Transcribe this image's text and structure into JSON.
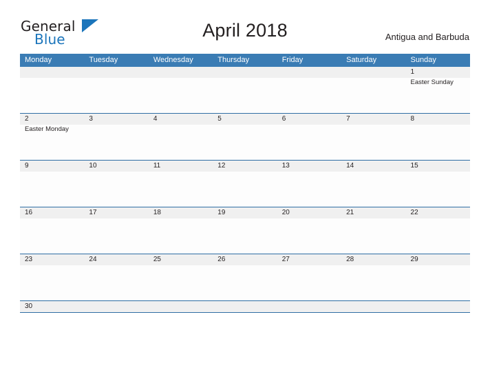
{
  "brand": {
    "word_one": "General",
    "word_two": "Blue",
    "triangle_icon": "triangle-right-icon",
    "color_dark": "#231f20",
    "color_blue": "#1b75bb"
  },
  "header": {
    "title": "April 2018",
    "region": "Antigua and Barbuda"
  },
  "theme": {
    "header_blue": "#3a7cb4",
    "rule_blue": "#2e6da4",
    "date_band_gray": "#f0f0f0",
    "body_white": "#fdfdfd",
    "text": "#231f20"
  },
  "calendar": {
    "weekdays": [
      "Monday",
      "Tuesday",
      "Wednesday",
      "Thursday",
      "Friday",
      "Saturday",
      "Sunday"
    ],
    "weeks": [
      {
        "short": false,
        "days": [
          {
            "num": "",
            "events": []
          },
          {
            "num": "",
            "events": []
          },
          {
            "num": "",
            "events": []
          },
          {
            "num": "",
            "events": []
          },
          {
            "num": "",
            "events": []
          },
          {
            "num": "",
            "events": []
          },
          {
            "num": "1",
            "events": [
              "Easter Sunday"
            ]
          }
        ]
      },
      {
        "short": false,
        "days": [
          {
            "num": "2",
            "events": [
              "Easter Monday"
            ]
          },
          {
            "num": "3",
            "events": []
          },
          {
            "num": "4",
            "events": []
          },
          {
            "num": "5",
            "events": []
          },
          {
            "num": "6",
            "events": []
          },
          {
            "num": "7",
            "events": []
          },
          {
            "num": "8",
            "events": []
          }
        ]
      },
      {
        "short": false,
        "days": [
          {
            "num": "9",
            "events": []
          },
          {
            "num": "10",
            "events": []
          },
          {
            "num": "11",
            "events": []
          },
          {
            "num": "12",
            "events": []
          },
          {
            "num": "13",
            "events": []
          },
          {
            "num": "14",
            "events": []
          },
          {
            "num": "15",
            "events": []
          }
        ]
      },
      {
        "short": false,
        "days": [
          {
            "num": "16",
            "events": []
          },
          {
            "num": "17",
            "events": []
          },
          {
            "num": "18",
            "events": []
          },
          {
            "num": "19",
            "events": []
          },
          {
            "num": "20",
            "events": []
          },
          {
            "num": "21",
            "events": []
          },
          {
            "num": "22",
            "events": []
          }
        ]
      },
      {
        "short": false,
        "days": [
          {
            "num": "23",
            "events": []
          },
          {
            "num": "24",
            "events": []
          },
          {
            "num": "25",
            "events": []
          },
          {
            "num": "26",
            "events": []
          },
          {
            "num": "27",
            "events": []
          },
          {
            "num": "28",
            "events": []
          },
          {
            "num": "29",
            "events": []
          }
        ]
      },
      {
        "short": true,
        "days": [
          {
            "num": "30",
            "events": []
          },
          {
            "num": "",
            "events": []
          },
          {
            "num": "",
            "events": []
          },
          {
            "num": "",
            "events": []
          },
          {
            "num": "",
            "events": []
          },
          {
            "num": "",
            "events": []
          },
          {
            "num": "",
            "events": []
          }
        ]
      }
    ]
  }
}
